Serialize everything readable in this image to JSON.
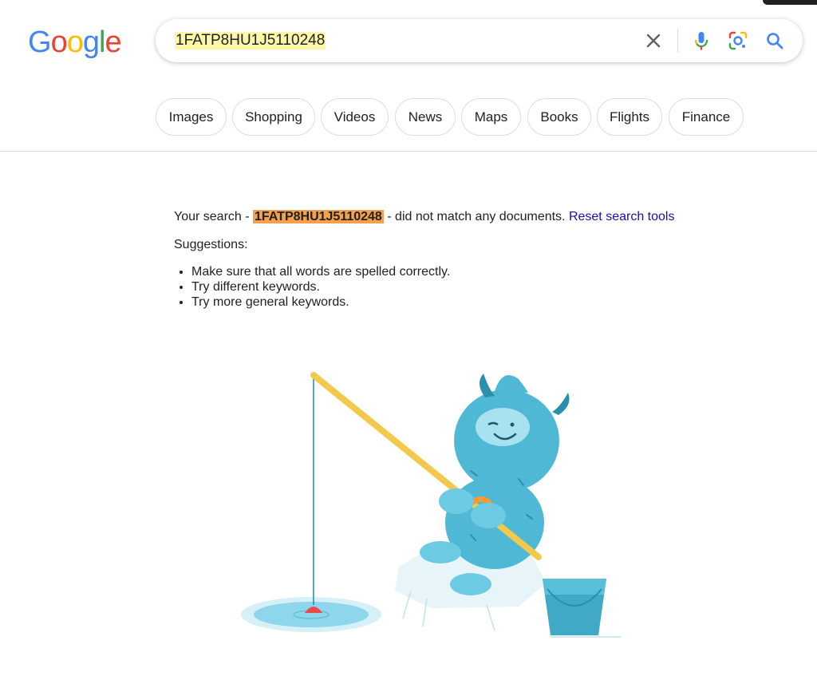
{
  "logo": {
    "letters": [
      "G",
      "o",
      "o",
      "g",
      "l",
      "e"
    ],
    "colors": [
      "#4285F4",
      "#EA4335",
      "#FBBC05",
      "#4285F4",
      "#34A853",
      "#EA4335"
    ]
  },
  "search": {
    "query": "1FATP8HU1J5110248",
    "clear_icon": "close-icon",
    "voice_icon": "mic-icon",
    "lens_icon": "camera-lens-icon",
    "search_icon": "search-icon"
  },
  "tabs": [
    {
      "label": "Images"
    },
    {
      "label": "Shopping"
    },
    {
      "label": "Videos"
    },
    {
      "label": "News"
    },
    {
      "label": "Maps"
    },
    {
      "label": "Books"
    },
    {
      "label": "Flights"
    },
    {
      "label": "Finance"
    }
  ],
  "results": {
    "prefix": "Your search - ",
    "query": "1FATP8HU1J5110248",
    "suffix": " - did not match any documents. ",
    "reset_link": "Reset search tools",
    "suggestions_title": "Suggestions:",
    "suggestions": [
      "Make sure that all words are spelled correctly.",
      "Try different keywords.",
      "Try more general keywords."
    ]
  },
  "colors": {
    "query_highlight_box": "#fff7a8",
    "query_highlight_result": "#f4a04d",
    "link": "#1a0dab",
    "yeti": "#4fb8d4",
    "rod": "#f2c94c"
  }
}
